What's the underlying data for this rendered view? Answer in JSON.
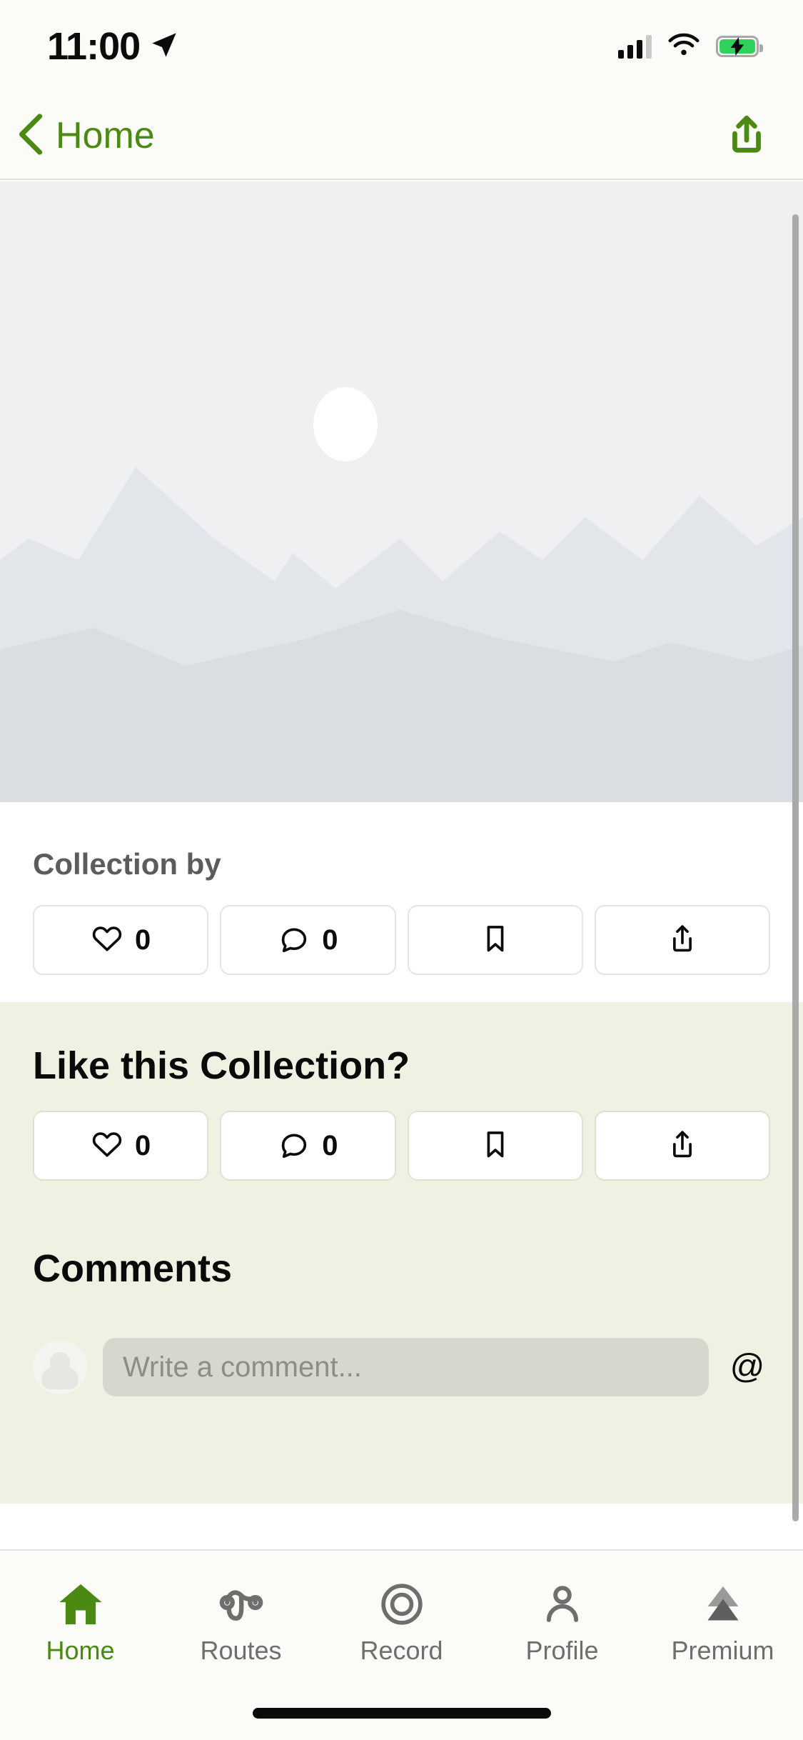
{
  "status_bar": {
    "time": "11:00",
    "location_arrow": "location-arrow-icon",
    "cellular": "cellular-bars-icon",
    "wifi": "wifi-icon",
    "battery": "battery-charging-icon",
    "battery_charging": true
  },
  "nav_bar": {
    "back_label": "Home",
    "back_icon": "chevron-left-icon",
    "share_icon": "share-up-icon"
  },
  "hero": {
    "type": "placeholder-landscape-image",
    "alt": "Mountain landscape placeholder"
  },
  "info": {
    "collection_by_label": "Collection by",
    "actions": [
      {
        "icon": "heart-icon",
        "count": "0"
      },
      {
        "icon": "comment-icon",
        "count": "0"
      },
      {
        "icon": "bookmark-icon",
        "count": ""
      },
      {
        "icon": "share-icon",
        "count": ""
      }
    ]
  },
  "like_section": {
    "title": "Like this Collection?",
    "actions": [
      {
        "icon": "heart-icon",
        "count": "0"
      },
      {
        "icon": "comment-icon",
        "count": "0"
      },
      {
        "icon": "bookmark-icon",
        "count": ""
      },
      {
        "icon": "share-icon",
        "count": ""
      }
    ]
  },
  "comments_section": {
    "title": "Comments",
    "input_placeholder": "Write a comment...",
    "input_value": "",
    "mention_label": "@",
    "avatar": "avatar-placeholder"
  },
  "tab_bar": {
    "active": "Home",
    "items": [
      {
        "label": "Home",
        "icon": "house-icon"
      },
      {
        "label": "Routes",
        "icon": "route-path-icon"
      },
      {
        "label": "Record",
        "icon": "record-target-icon"
      },
      {
        "label": "Profile",
        "icon": "person-icon"
      },
      {
        "label": "Premium",
        "icon": "mountain-peaks-icon"
      }
    ]
  },
  "colors": {
    "accent_green": "#4a8a12",
    "battery_green": "#2fd35b",
    "cream_section": "#f1f1e3",
    "page_background": "#fbfbf8",
    "muted_gray": "#6e6e6e"
  }
}
